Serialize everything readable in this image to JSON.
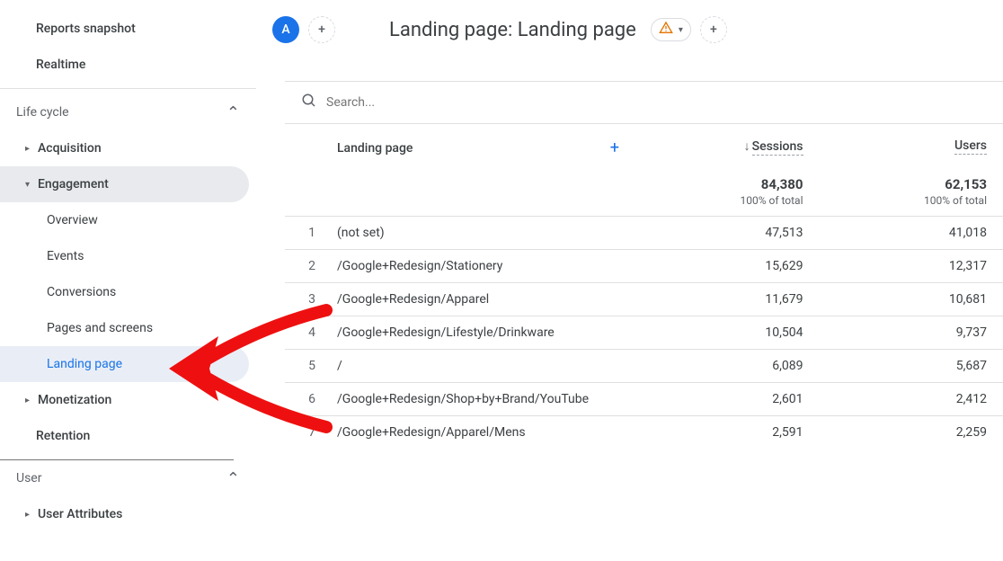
{
  "sidebar": {
    "reports_snapshot": "Reports snapshot",
    "realtime": "Realtime",
    "life_cycle": "Life cycle",
    "acquisition": "Acquisition",
    "engagement": "Engagement",
    "overview": "Overview",
    "events": "Events",
    "conversions": "Conversions",
    "pages_screens": "Pages and screens",
    "landing_page": "Landing page",
    "monetization": "Monetization",
    "retention": "Retention",
    "user": "User",
    "user_attributes": "User Attributes"
  },
  "header": {
    "title": "Landing page: Landing page",
    "badge_letter": "A"
  },
  "search": {
    "placeholder": "Search..."
  },
  "table": {
    "col_dimension": "Landing page",
    "col_sessions": "Sessions",
    "col_users": "Users",
    "totals_sessions": "84,380",
    "totals_users": "62,153",
    "totals_sub": "100% of total",
    "rows": [
      {
        "n": "1",
        "page": "(not set)",
        "sessions": "47,513",
        "users": "41,018"
      },
      {
        "n": "2",
        "page": "/Google+Redesign/Stationery",
        "sessions": "15,629",
        "users": "12,317"
      },
      {
        "n": "3",
        "page": "/Google+Redesign/Apparel",
        "sessions": "11,679",
        "users": "10,681"
      },
      {
        "n": "4",
        "page": "/Google+Redesign/Lifestyle/Drinkware",
        "sessions": "10,504",
        "users": "9,737"
      },
      {
        "n": "5",
        "page": "/",
        "sessions": "6,089",
        "users": "5,687"
      },
      {
        "n": "6",
        "page": "/Google+Redesign/Shop+by+Brand/YouTube",
        "sessions": "2,601",
        "users": "2,412"
      },
      {
        "n": "7",
        "page": "/Google+Redesign/Apparel/Mens",
        "sessions": "2,591",
        "users": "2,259"
      }
    ]
  }
}
